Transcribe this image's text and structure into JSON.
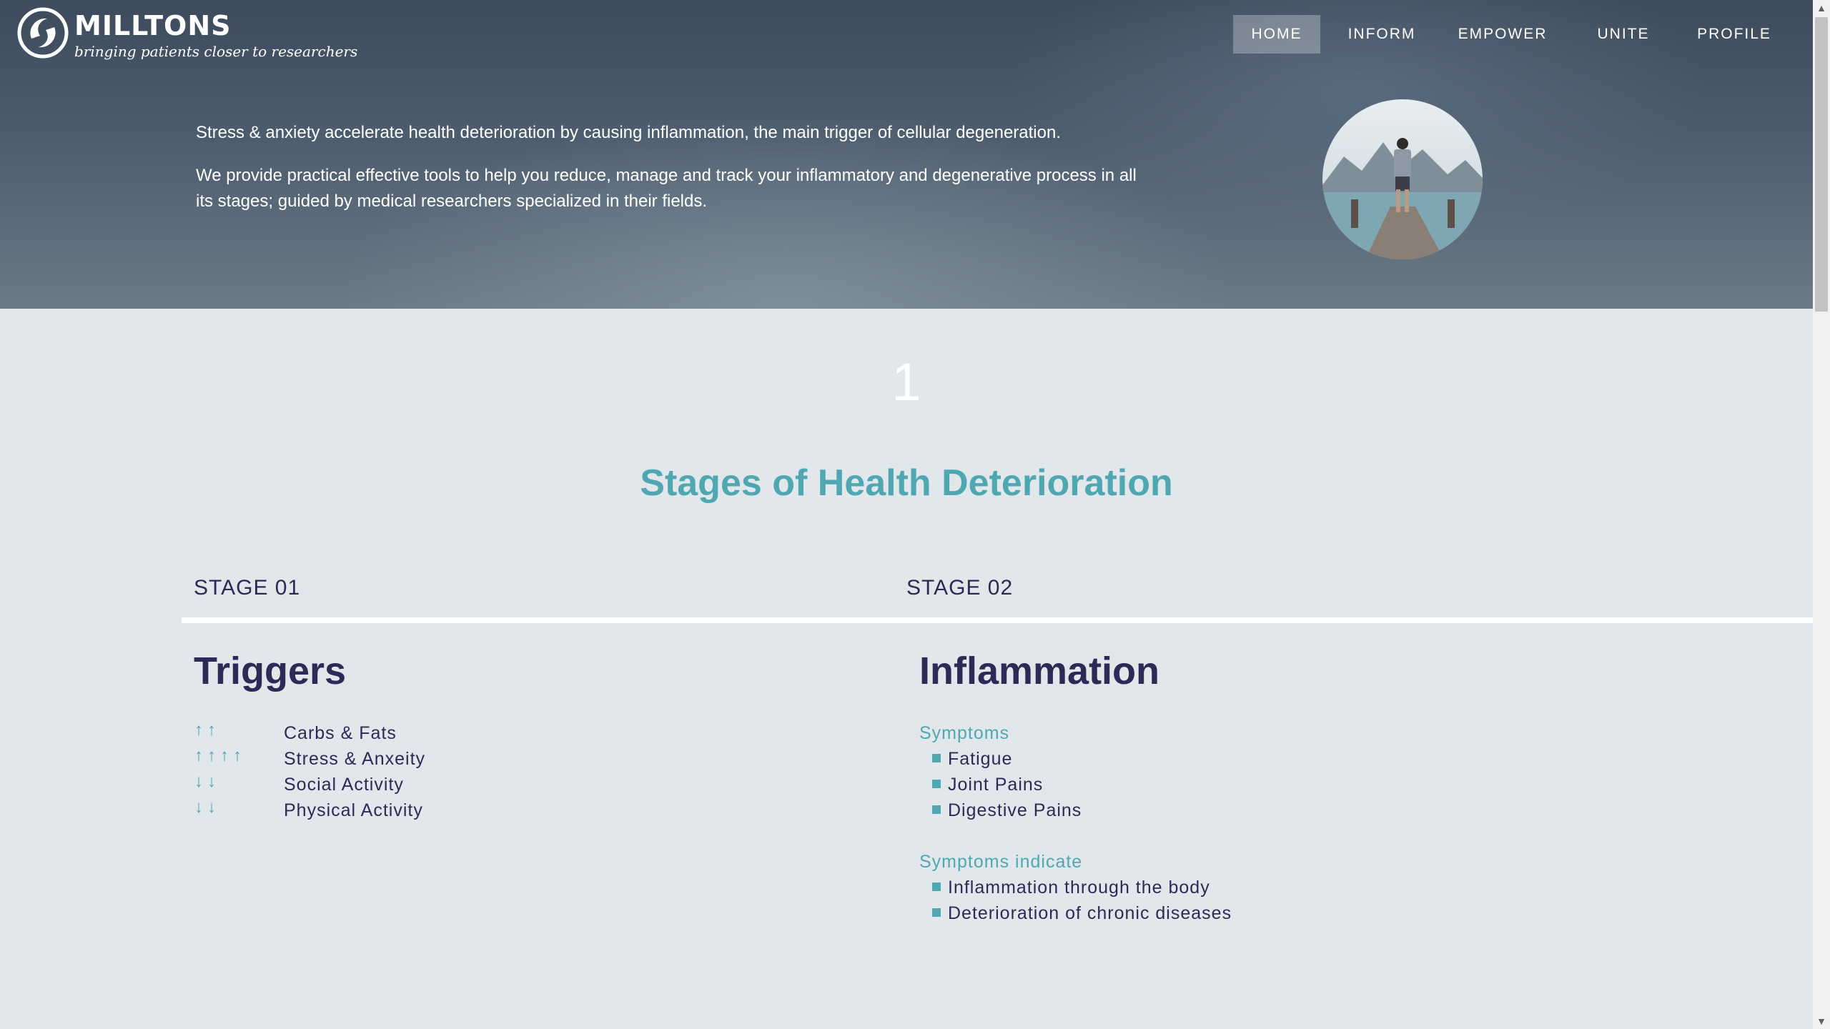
{
  "brand": {
    "name": "MILLTONS",
    "tagline": "bringing patients closer to researchers"
  },
  "nav": {
    "items": [
      {
        "label": "HOME",
        "active": true
      },
      {
        "label": "INFORM",
        "active": false
      },
      {
        "label": "EMPOWER",
        "active": false
      },
      {
        "label": "UNITE",
        "active": false
      },
      {
        "label": "PROFILE",
        "active": false
      }
    ]
  },
  "hero": {
    "paragraph1": "Stress & anxiety accelerate health deterioration by causing inflammation, the main trigger of cellular degeneration.",
    "paragraph2": "We provide practical effective tools to help you reduce, manage and track your inflammatory and degenerative process in all its stages; guided by medical researchers specialized in their fields."
  },
  "section": {
    "number": "1",
    "title": "Stages of Health Deterioration"
  },
  "stages": {
    "stage1": {
      "label": "STAGE 01",
      "title": "Triggers",
      "items": [
        {
          "arrows": "↑↑",
          "label": "Carbs & Fats"
        },
        {
          "arrows": "↑↑↑↑",
          "label": "Stress & Anxeity"
        },
        {
          "arrows": "↓↓",
          "label": "Social Activity"
        },
        {
          "arrows": "↓↓",
          "label": "Physical Activity"
        }
      ]
    },
    "stage2": {
      "label": "STAGE 02",
      "title": "Inflammation",
      "symptoms_heading": "Symptoms",
      "symptoms": [
        "Fatigue",
        "Joint Pains",
        "Digestive Pains"
      ],
      "indicate_heading": "Symptoms indicate",
      "indicate": [
        "Inflammation through the body",
        "Deterioration of chronic diseases"
      ]
    }
  },
  "colors": {
    "accent": "#4fa8b1",
    "heading": "#2b2b55",
    "background": "#e2e7eb"
  }
}
